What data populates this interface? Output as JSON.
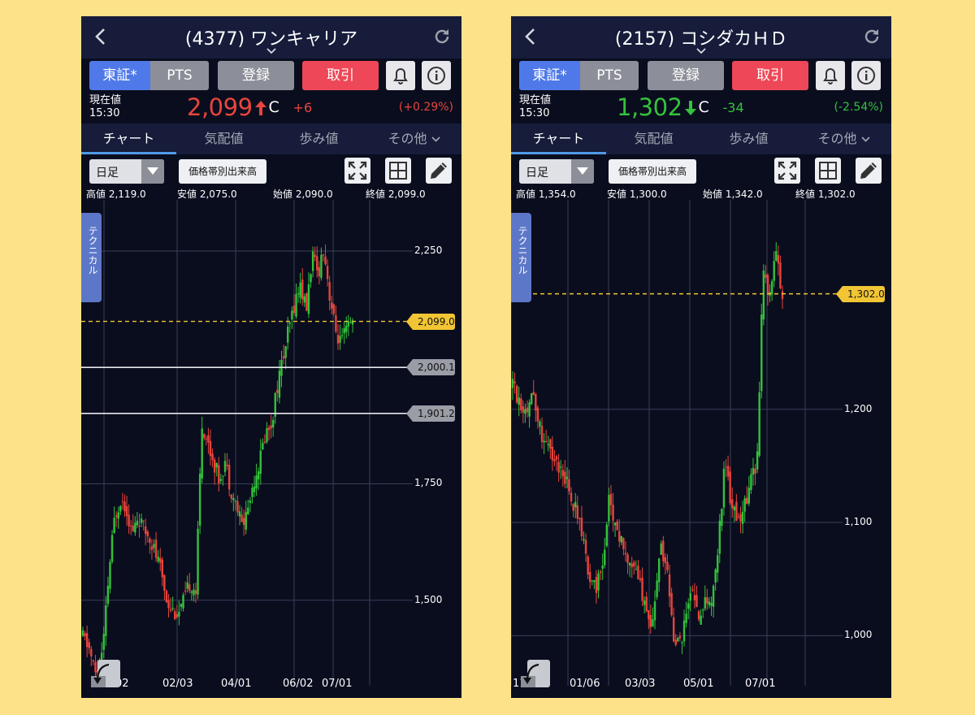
{
  "colors": {
    "background": "#fde28a",
    "up": "#e8453c",
    "down": "#34c23c",
    "accent": "#4f79e8",
    "trade": "#ee4757",
    "last_price_line": "#f1c534"
  },
  "phones": [
    {
      "title": "(4377) ワンキャリア",
      "exchange": "東証*",
      "pts": "PTS",
      "register": "登録",
      "trade": "取引",
      "price_label": "現在値",
      "time": "15:30",
      "price": "2,099",
      "direction": "up",
      "c": "C",
      "change": "+6",
      "change_pct": "(+0.29%)",
      "tabs": [
        "チャート",
        "気配値",
        "歩み値",
        "その他"
      ],
      "period": "日足",
      "volume_button": "価格帯別出来高",
      "ohlc": {
        "high_label": "高値",
        "high": "2,119.0",
        "low_label": "安値",
        "low": "2,075.0",
        "open_label": "始値",
        "open": "2,090.0",
        "close_label": "終値",
        "close": "2,099.0"
      },
      "technical": "テクニカル",
      "y_ticks": [
        "2,250",
        "1,750",
        "1,500"
      ],
      "last_tag": "2,099.0",
      "line_tags": [
        "2,000.1",
        "1,901.2"
      ],
      "x_ticks": [
        "02",
        "02/03",
        "04/01",
        "06/02",
        "07/01"
      ],
      "icons": [
        "back-arrow-icon",
        "refresh-icon",
        "chevron-down-icon",
        "bell-icon",
        "info-icon",
        "expand-icon",
        "grid-icon",
        "pencil-icon",
        "undo-icon"
      ]
    },
    {
      "title": "(2157) コシダカＨＤ",
      "exchange": "東証*",
      "pts": "PTS",
      "register": "登録",
      "trade": "取引",
      "price_label": "現在値",
      "time": "15:30",
      "price": "1,302",
      "direction": "down",
      "c": "C",
      "change": "-34",
      "change_pct": "(-2.54%)",
      "tabs": [
        "チャート",
        "気配値",
        "歩み値",
        "その他"
      ],
      "period": "日足",
      "volume_button": "価格帯別出来高",
      "ohlc": {
        "high_label": "高値",
        "high": "1,354.0",
        "low_label": "安値",
        "low": "1,300.0",
        "open_label": "始値",
        "open": "1,342.0",
        "close_label": "終値",
        "close": "1,302.0"
      },
      "technical": "テクニカル",
      "y_ticks": [
        "1,200",
        "1,100",
        "1,000"
      ],
      "last_tag": "1,302.0",
      "line_tags": [],
      "x_ticks": [
        "11",
        "01/06",
        "03/03",
        "05/01",
        "07/01"
      ],
      "icons": [
        "back-arrow-icon",
        "refresh-icon",
        "chevron-down-icon",
        "bell-icon",
        "info-icon",
        "expand-icon",
        "grid-icon",
        "pencil-icon",
        "undo-icon"
      ]
    }
  ],
  "chart_data": [
    {
      "type": "candlestick",
      "title": "(4377) ワンキャリア",
      "interval": "日足",
      "ylim": [
        1290,
        2360
      ],
      "y_ticks": [
        2250,
        1750,
        1500
      ],
      "x_ticks": [
        "02",
        "02/03",
        "04/01",
        "06/02",
        "07/01"
      ],
      "last_price": 2099.0,
      "horizontal_lines": [
        2000.1,
        1901.2
      ],
      "ohlc_latest": {
        "open": 2090.0,
        "high": 2119.0,
        "low": 2075.0,
        "close": 2099.0
      },
      "path": [
        [
          0,
          1420
        ],
        [
          4,
          1400
        ],
        [
          7,
          1360
        ],
        [
          10,
          1330
        ],
        [
          14,
          1400
        ],
        [
          18,
          1560
        ],
        [
          22,
          1680
        ],
        [
          26,
          1720
        ],
        [
          30,
          1700
        ],
        [
          34,
          1640
        ],
        [
          38,
          1680
        ],
        [
          42,
          1650
        ],
        [
          46,
          1640
        ],
        [
          50,
          1600
        ],
        [
          54,
          1560
        ],
        [
          58,
          1500
        ],
        [
          62,
          1480
        ],
        [
          66,
          1470
        ],
        [
          70,
          1500
        ],
        [
          74,
          1540
        ],
        [
          78,
          1520
        ],
        [
          82,
          1880
        ],
        [
          86,
          1840
        ],
        [
          90,
          1800
        ],
        [
          94,
          1760
        ],
        [
          98,
          1800
        ],
        [
          102,
          1740
        ],
        [
          106,
          1700
        ],
        [
          110,
          1660
        ],
        [
          114,
          1700
        ],
        [
          118,
          1760
        ],
        [
          122,
          1800
        ],
        [
          126,
          1860
        ],
        [
          130,
          1880
        ],
        [
          134,
          1960
        ],
        [
          138,
          2020
        ],
        [
          142,
          2080
        ],
        [
          146,
          2140
        ],
        [
          150,
          2180
        ],
        [
          154,
          2120
        ],
        [
          158,
          2240
        ],
        [
          162,
          2200
        ],
        [
          166,
          2260
        ],
        [
          170,
          2160
        ],
        [
          174,
          2080
        ],
        [
          178,
          2050
        ],
        [
          182,
          2080
        ],
        [
          186,
          2099
        ]
      ]
    },
    {
      "type": "candlestick",
      "title": "(2157) コシダカＨＤ",
      "interval": "日足",
      "ylim": [
        945,
        1385
      ],
      "y_ticks": [
        1200,
        1100,
        1000
      ],
      "x_ticks": [
        "11",
        "01/06",
        "03/03",
        "05/01",
        "07/01"
      ],
      "last_price": 1302.0,
      "ohlc_latest": {
        "open": 1342.0,
        "high": 1354.0,
        "low": 1300.0,
        "close": 1302.0
      },
      "path": [
        [
          0,
          1220
        ],
        [
          4,
          1210
        ],
        [
          8,
          1200
        ],
        [
          12,
          1215
        ],
        [
          16,
          1190
        ],
        [
          20,
          1170
        ],
        [
          24,
          1160
        ],
        [
          28,
          1150
        ],
        [
          32,
          1145
        ],
        [
          36,
          1120
        ],
        [
          40,
          1110
        ],
        [
          44,
          1080
        ],
        [
          48,
          1050
        ],
        [
          52,
          1045
        ],
        [
          56,
          1060
        ],
        [
          60,
          1120
        ],
        [
          64,
          1100
        ],
        [
          68,
          1080
        ],
        [
          72,
          1070
        ],
        [
          76,
          1060
        ],
        [
          80,
          1040
        ],
        [
          84,
          1010
        ],
        [
          88,
          1020
        ],
        [
          92,
          1080
        ],
        [
          96,
          1060
        ],
        [
          100,
          1000
        ],
        [
          104,
          990
        ],
        [
          108,
          1020
        ],
        [
          112,
          1040
        ],
        [
          116,
          1010
        ],
        [
          120,
          1030
        ],
        [
          124,
          1030
        ],
        [
          128,
          1080
        ],
        [
          132,
          1150
        ],
        [
          136,
          1120
        ],
        [
          140,
          1100
        ],
        [
          144,
          1110
        ],
        [
          148,
          1140
        ],
        [
          152,
          1150
        ],
        [
          156,
          1320
        ],
        [
          160,
          1300
        ],
        [
          164,
          1340
        ],
        [
          168,
          1302
        ]
      ]
    }
  ]
}
